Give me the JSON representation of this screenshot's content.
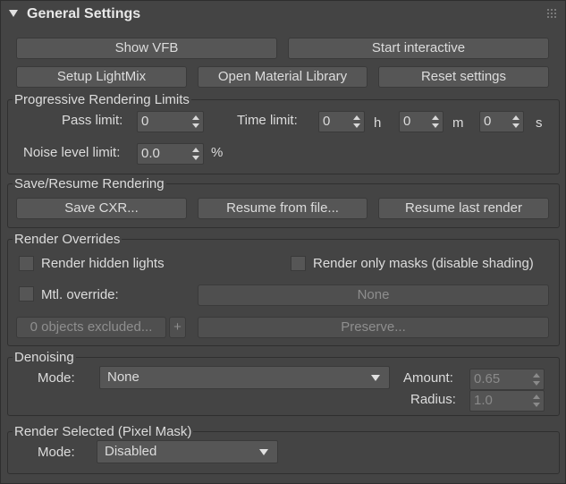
{
  "rollout": {
    "title": "General Settings"
  },
  "toolbar": {
    "show_vfb": "Show VFB",
    "start_interactive": "Start interactive",
    "setup_lightmix": "Setup LightMix",
    "open_material_library": "Open Material Library",
    "reset_settings": "Reset settings"
  },
  "progressive": {
    "title": "Progressive Rendering Limits",
    "pass_limit_label": "Pass limit:",
    "pass_limit_value": "0",
    "time_limit_label": "Time limit:",
    "hours_value": "0",
    "hours_unit": "h",
    "minutes_value": "0",
    "minutes_unit": "m",
    "seconds_value": "0",
    "seconds_unit": "s",
    "noise_label": "Noise level limit:",
    "noise_value": "0.0",
    "noise_unit": "%"
  },
  "save_resume": {
    "title": "Save/Resume Rendering",
    "save_cxr": "Save CXR...",
    "resume_from_file": "Resume from file...",
    "resume_last": "Resume last render"
  },
  "overrides": {
    "title": "Render Overrides",
    "hidden_lights": "Render hidden lights",
    "only_masks": "Render only masks (disable shading)",
    "mtl_override": "Mtl. override:",
    "mtl_value": "None",
    "excluded": "0 objects excluded...",
    "plus": "+",
    "preserve": "Preserve..."
  },
  "denoising": {
    "title": "Denoising",
    "mode_label": "Mode:",
    "mode_value": "None",
    "amount_label": "Amount:",
    "amount_value": "0.65",
    "radius_label": "Radius:",
    "radius_value": "1.0"
  },
  "pixel_mask": {
    "title": "Render Selected (Pixel Mask)",
    "mode_label": "Mode:",
    "mode_value": "Disabled"
  }
}
